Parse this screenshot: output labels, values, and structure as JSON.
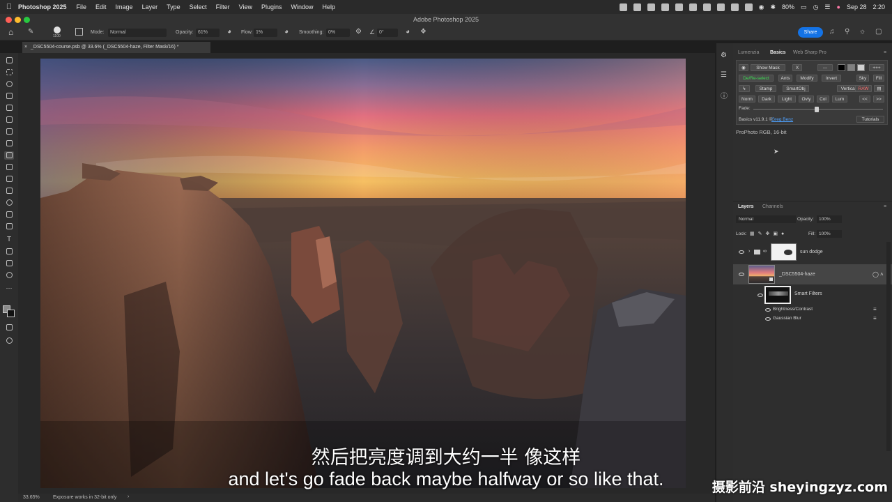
{
  "menubar": {
    "app_name": "Photoshop 2025",
    "items": [
      "File",
      "Edit",
      "Image",
      "Layer",
      "Type",
      "Select",
      "Filter",
      "View",
      "Plugins",
      "Window",
      "Help"
    ],
    "battery": "80%",
    "date": "Sep 28",
    "time": "2:20"
  },
  "window": {
    "title": "Adobe Photoshop 2025"
  },
  "options_bar": {
    "brush_size": "1100",
    "mode_label": "Mode:",
    "mode_value": "Normal",
    "opacity_label": "Opacity:",
    "opacity_value": "61%",
    "flow_label": "Flow:",
    "flow_value": "1%",
    "smoothing_label": "Smoothing:",
    "smoothing_value": "0%",
    "angle_value": "0°",
    "share_label": "Share"
  },
  "document": {
    "tab_title": "_DSC5504-course.psb @ 33.6% (_DSC5504-haze, Filter Mask/16) *"
  },
  "status": {
    "zoom": "33.65%",
    "message": "Exposure works in 32-bit only"
  },
  "panels": {
    "top_tabs": [
      "Lumenzia",
      "Basics",
      "Web Sharp Pro"
    ],
    "basics": {
      "show_mask": "Show Mask",
      "x": "X",
      "dashes": "---",
      "plus": "+++",
      "row2": [
        "De/Re-select",
        "Ants",
        "Modify",
        "Invert",
        "Sky",
        "Fill"
      ],
      "row3": [
        "Stamp",
        "SmartObj",
        "Verticals",
        "RAW"
      ],
      "row4": [
        "Norm",
        "Dark",
        "Light",
        "Ovly",
        "Col",
        "Lum",
        "<<",
        ">>"
      ],
      "fade_label": "Fade:",
      "version": "Basics v11.9.1 ©",
      "author": "Greg Benz",
      "tutorials": "Tutorials"
    },
    "color_profile": "ProPhoto RGB, 16-bit",
    "layers_tabs": [
      "Layers",
      "Channels"
    ],
    "blend_mode": "Normal",
    "opacity_label": "Opacity:",
    "opacity_value": "100%",
    "lock_label": "Lock:",
    "fill_label": "Fill:",
    "fill_value": "100%",
    "layers": [
      {
        "name": "sun dodge"
      },
      {
        "name": "_DSC5504-haze"
      }
    ],
    "smart_filters_label": "Smart Filters",
    "filters": [
      "Brightness/Contrast",
      "Gaussian Blur"
    ]
  },
  "subtitles": {
    "chinese": "然后把亮度调到大约一半 像这样",
    "english": "and let's go fade back maybe halfway or so like that."
  },
  "watermark": "摄影前沿 sheyingzyz.com",
  "colors": {
    "accent_blue": "#1473e6",
    "lumenzia_green": "#3ddc54",
    "raw_red": "#ff6b6b"
  }
}
